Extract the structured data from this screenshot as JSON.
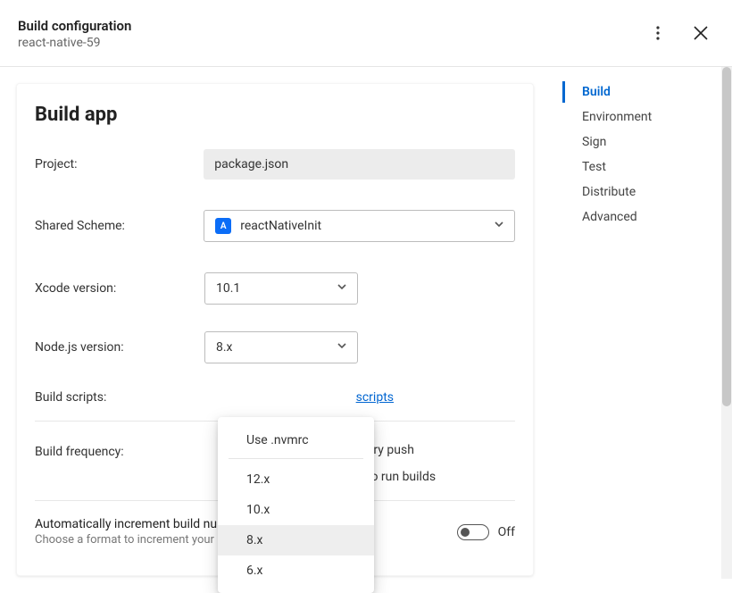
{
  "header": {
    "title": "Build configuration",
    "subtitle": "react-native-59"
  },
  "sidebar": {
    "items": [
      {
        "label": "Build",
        "active": true
      },
      {
        "label": "Environment",
        "active": false
      },
      {
        "label": "Sign",
        "active": false
      },
      {
        "label": "Test",
        "active": false
      },
      {
        "label": "Distribute",
        "active": false
      },
      {
        "label": "Advanced",
        "active": false
      }
    ]
  },
  "main": {
    "heading": "Build app",
    "fields": {
      "project_label": "Project:",
      "project_value": "package.json",
      "scheme_label": "Shared Scheme:",
      "scheme_value": "reactNativeInit",
      "xcode_label": "Xcode version:",
      "xcode_value": "10.1",
      "node_label": "Node.js version:",
      "node_value": "8.x",
      "scripts_label": "Build scripts:",
      "scripts_link_suffix": "scripts"
    },
    "node_dropdown": {
      "first": "Use .nvmrc",
      "options": [
        "12.x",
        "10.x",
        "8.x",
        "6.x"
      ],
      "selected": "8.x"
    },
    "freq": {
      "label": "Build frequency:",
      "opts": [
        {
          "label_suffix": "ery push",
          "checked": true
        },
        {
          "label_suffix": "to run builds",
          "checked": false
        }
      ]
    },
    "auto": {
      "title": "Automatically increment build number",
      "sub": "Choose a format to increment your builds.",
      "toggle_state": "Off"
    }
  }
}
